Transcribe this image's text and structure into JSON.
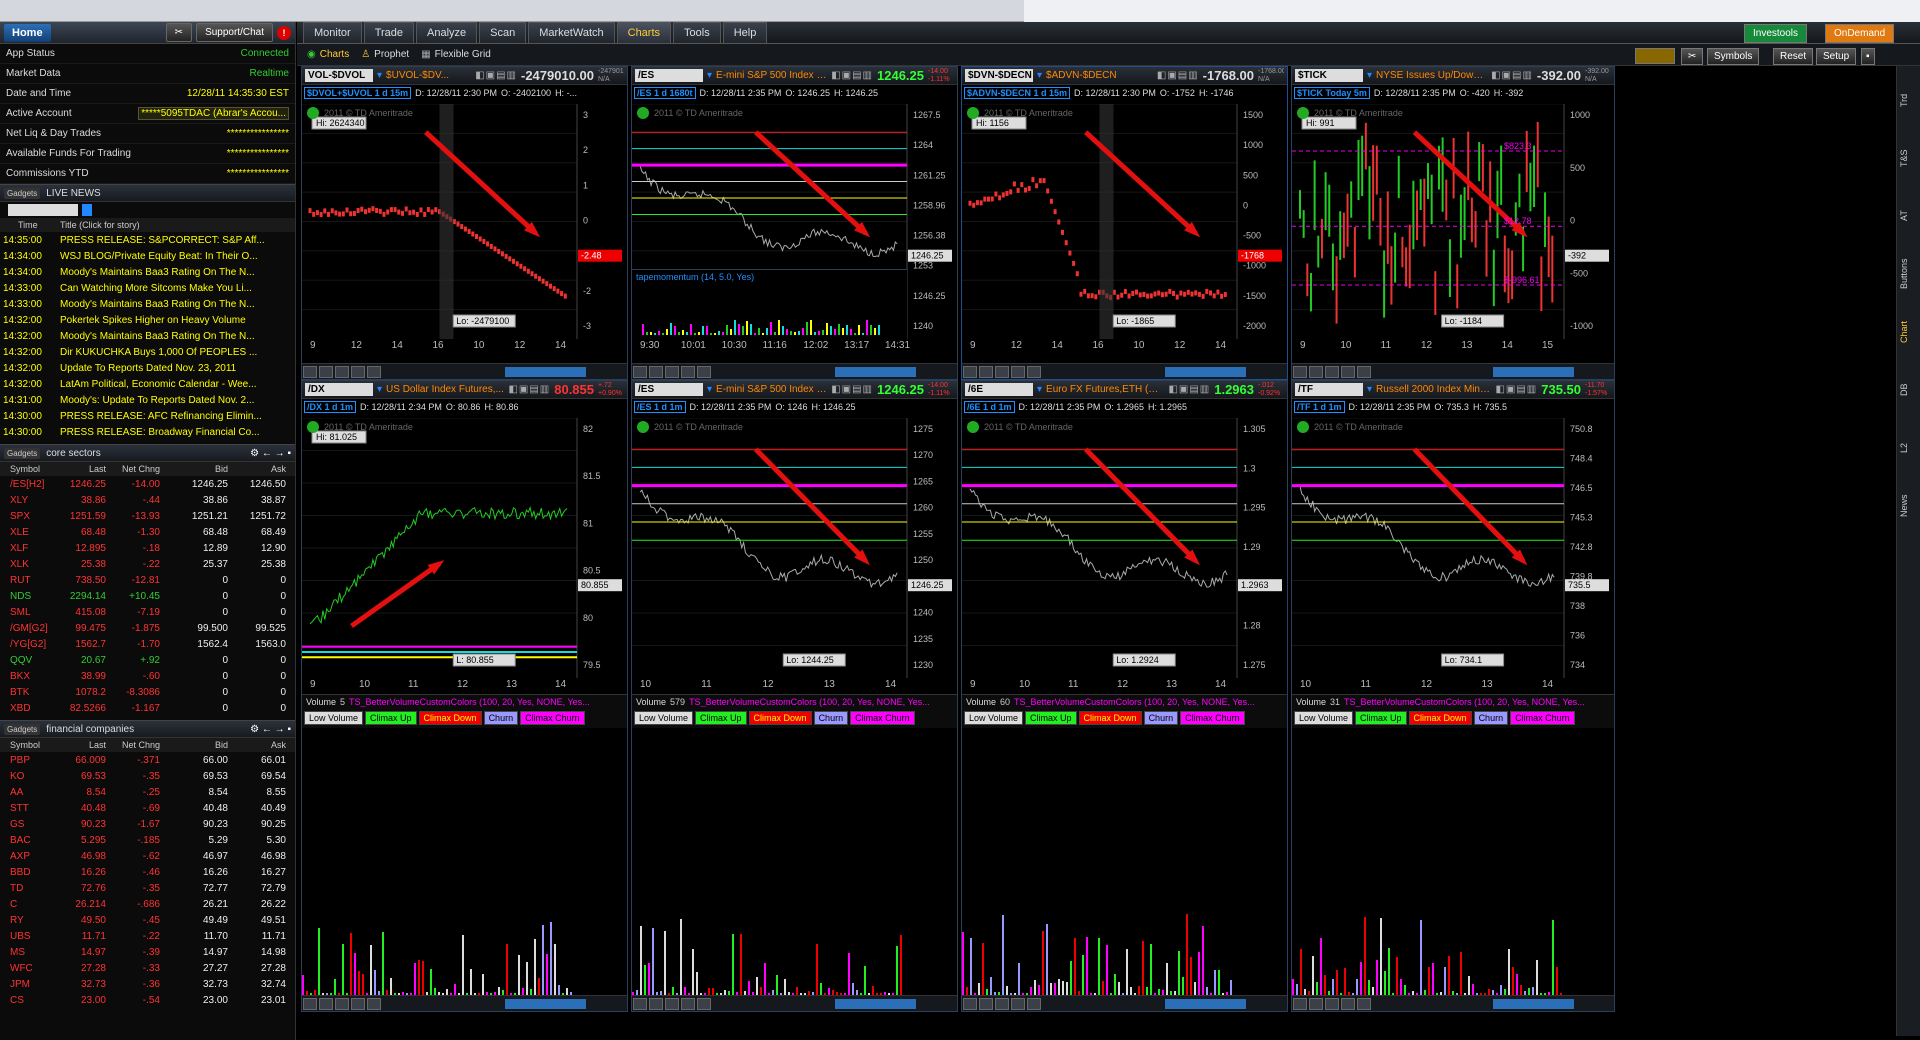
{
  "left": {
    "home": "Home",
    "support": "Support/Chat",
    "status": [
      {
        "k": "App Status",
        "v": "Connected"
      },
      {
        "k": "Market Data",
        "v": "Realtime"
      },
      {
        "k": "Date and Time",
        "v": "12/28/11 14:35:30 EST"
      },
      {
        "k": "Active Account",
        "v": "*****5095TDAC (Abrar's Accou..."
      },
      {
        "k": "Net Liq & Day Trades",
        "v": "****************"
      },
      {
        "k": "Available Funds For Trading",
        "v": "****************"
      },
      {
        "k": "Commissions YTD",
        "v": "****************"
      }
    ],
    "news_title": "LIVE NEWS",
    "gadgets": "Gadgets",
    "news_cols": [
      "Time",
      "Title (Click for story)"
    ],
    "news": [
      {
        "t": "14:35:00",
        "s": "PRESS RELEASE: S&PCORRECT: S&P Aff..."
      },
      {
        "t": "14:34:00",
        "s": "WSJ BLOG/Private Equity Beat: In Their O..."
      },
      {
        "t": "14:34:00",
        "s": "Moody's Maintains Baa3 Rating On The N..."
      },
      {
        "t": "14:33:00",
        "s": "Can Watching More Sitcoms Make You Li..."
      },
      {
        "t": "14:33:00",
        "s": "Moody's Maintains Baa3 Rating On The N..."
      },
      {
        "t": "14:32:00",
        "s": "Pokertek Spikes Higher on Heavy Volume"
      },
      {
        "t": "14:32:00",
        "s": "Moody's Maintains Baa3 Rating On The N..."
      },
      {
        "t": "14:32:00",
        "s": "Dir KUKUCHKA Buys 1,000 Of PEOPLES ..."
      },
      {
        "t": "14:32:00",
        "s": "Update To Reports Dated Nov. 23, 2011"
      },
      {
        "t": "14:32:00",
        "s": "LatAm Political, Economic Calendar - Wee..."
      },
      {
        "t": "14:31:00",
        "s": "Moody's: Update To Reports Dated Nov. 2..."
      },
      {
        "t": "14:30:00",
        "s": "PRESS RELEASE: AFC Refinancing Elimin..."
      },
      {
        "t": "14:30:00",
        "s": "PRESS RELEASE: Broadway Financial Co..."
      }
    ],
    "core_title": "core sectors",
    "quote_cols": [
      "Symbol",
      "Last",
      "Net Chng",
      "Bid",
      "Ask"
    ],
    "core": [
      [
        "/ES[H2]",
        "1246.25",
        "-14.00",
        "1246.25",
        "1246.50",
        "r"
      ],
      [
        "XLY",
        "38.86",
        "-.44",
        "38.86",
        "38.87",
        "r"
      ],
      [
        "SPX",
        "1251.59",
        "-13.93",
        "1251.21",
        "1251.72",
        "r"
      ],
      [
        "XLE",
        "68.48",
        "-1.30",
        "68.48",
        "68.49",
        "r"
      ],
      [
        "XLF",
        "12.895",
        "-.18",
        "12.89",
        "12.90",
        "r"
      ],
      [
        "XLK",
        "25.38",
        "-.22",
        "25.37",
        "25.38",
        "r"
      ],
      [
        "RUT",
        "738.50",
        "-12.81",
        "0",
        "0",
        "r"
      ],
      [
        "NDS",
        "2294.14",
        "+10.45",
        "0",
        "0",
        "g"
      ],
      [
        "SML",
        "415.08",
        "-7.19",
        "0",
        "0",
        "r"
      ],
      [
        "/GM[G2]",
        "99.475",
        "-1.875",
        "99.500",
        "99.525",
        "r"
      ],
      [
        "/YG[G2]",
        "1562.7",
        "-1.70",
        "1562.4",
        "1563.0",
        "r"
      ],
      [
        "QQV",
        "20.67",
        "+.92",
        "0",
        "0",
        "g"
      ],
      [
        "BKX",
        "38.99",
        "-.60",
        "0",
        "0",
        "r"
      ],
      [
        "BTK",
        "1078.2",
        "-8.3086",
        "0",
        "0",
        "r"
      ],
      [
        "XBD",
        "82.5266",
        "-1.167",
        "0",
        "0",
        "r"
      ]
    ],
    "fin_title": "financial companies",
    "fin": [
      [
        "PBP",
        "66.009",
        "-.371",
        "66.00",
        "66.01",
        "r"
      ],
      [
        "KO",
        "69.53",
        "-.35",
        "69.53",
        "69.54",
        "r"
      ],
      [
        "AA",
        "8.54",
        "-.25",
        "8.54",
        "8.55",
        "r"
      ],
      [
        "STT",
        "40.48",
        "-.69",
        "40.48",
        "40.49",
        "r"
      ],
      [
        "GS",
        "90.23",
        "-1.67",
        "90.23",
        "90.25",
        "r"
      ],
      [
        "BAC",
        "5.295",
        "-.185",
        "5.29",
        "5.30",
        "r"
      ],
      [
        "AXP",
        "46.98",
        "-.62",
        "46.97",
        "46.98",
        "r"
      ],
      [
        "BBD",
        "16.26",
        "-.46",
        "16.26",
        "16.27",
        "r"
      ],
      [
        "TD",
        "72.76",
        "-.35",
        "72.77",
        "72.79",
        "r"
      ],
      [
        "C",
        "26.214",
        "-.686",
        "26.21",
        "26.22",
        "r"
      ],
      [
        "RY",
        "49.50",
        "-.45",
        "49.49",
        "49.51",
        "r"
      ],
      [
        "UBS",
        "11.71",
        "-.22",
        "11.70",
        "11.71",
        "r"
      ],
      [
        "MS",
        "14.97",
        "-.39",
        "14.97",
        "14.98",
        "r"
      ],
      [
        "WFC",
        "27.28",
        "-.33",
        "27.27",
        "27.28",
        "r"
      ],
      [
        "JPM",
        "32.73",
        "-.36",
        "32.73",
        "32.74",
        "r"
      ],
      [
        "CS",
        "23.00",
        "-.54",
        "23.00",
        "23.01",
        "r"
      ]
    ]
  },
  "nav": {
    "tabs": [
      "Monitor",
      "Trade",
      "Analyze",
      "Scan",
      "MarketWatch",
      "Charts",
      "Tools",
      "Help"
    ],
    "sub": [
      "Charts",
      "Prophet",
      "Flexible Grid"
    ],
    "right": [
      "Investools",
      "OnDemand"
    ],
    "ctl": [
      "Symbols",
      "Reset",
      "Setup"
    ],
    "side": [
      "Trd",
      "T&S",
      "AT",
      "Buttons",
      "Chart",
      "DB",
      "L2",
      "News"
    ]
  },
  "panels": [
    {
      "sym": "VOL-$DVOL",
      "desc": "$UVOL-$DV...",
      "price": "-2479010.00",
      "chg": "-2479010.00 N/A",
      "pc": "",
      "info": "$DVOL+$UVOL 1 d 15m",
      "date": "D: 12/28/11 2:30 PM",
      "o": "O: -2402100",
      "h": "H: -...",
      "hi": "Hi: 2624340",
      "lo": "Lo: -2479100",
      "last": "-2.48",
      "xt": [
        "9",
        "12",
        "14",
        "16",
        "10",
        "12",
        "14"
      ],
      "yt": [
        "3",
        "2",
        "1",
        "0",
        "-1",
        "-2",
        "-3"
      ]
    },
    {
      "sym": "/ES",
      "desc": "E-mini S&P 500 Index Futur...",
      "price": "1246.25",
      "chg": "-14.00 -1.11%",
      "pc": "g",
      "info": "/ES 1 d 1680t",
      "date": "D: 12/28/11 2:35 PM",
      "o": "O: 1246.25",
      "h": "H: 1246.25",
      "hi": "",
      "lo": "Lo: 1244.25",
      "last": "1246.25",
      "xt": [
        "9:30",
        "10:01",
        "10:30",
        "11:16",
        "12:02",
        "13:17",
        "14:31"
      ],
      "yt": [
        "1267.5",
        "1264",
        "1261.25",
        "1258.96",
        "1256.38",
        "1253",
        "1246.25",
        "1240"
      ],
      "study": "tapemomentum (14, 5.0, Yes)"
    },
    {
      "sym": "$DVN-$DECN",
      "desc": "$ADVN-$DECN",
      "price": "-1768.00",
      "chg": "-1768.00 N/A",
      "pc": "",
      "info": "$ADVN-$DECN 1 d 15m",
      "date": "D: 12/28/11 2:30 PM",
      "o": "O: -1752",
      "h": "H: -1746",
      "hi": "Hi: 1156",
      "lo": "Lo: -1865",
      "last": "-1768",
      "xt": [
        "9",
        "12",
        "14",
        "16",
        "10",
        "12",
        "14"
      ],
      "yt": [
        "1500",
        "1000",
        "500",
        "0",
        "-500",
        "-1000",
        "-1500",
        "-2000"
      ]
    },
    {
      "sym": "$TICK",
      "desc": "NYSE Issues Up/Down ...",
      "price": "-392.00",
      "chg": "-392.00 N/A",
      "pc": "",
      "info": "$TICK Today 5m",
      "date": "D: 12/28/11 2:35 PM",
      "o": "O: -420",
      "h": "H: -392",
      "hi": "Hi: 991",
      "lo": "Lo: -1184",
      "last": "-392",
      "xt": [
        "9",
        "10",
        "11",
        "12",
        "13",
        "14",
        "15"
      ],
      "yt": [
        "1000",
        "500",
        "0",
        "-500",
        "-1000"
      ],
      "lines": [
        "$823.3",
        "$12.78",
        "$-996.61"
      ]
    },
    {
      "sym": "/DX",
      "desc": "US Dollar Index Futures,...",
      "price": "80.855",
      "chg": "+.72 +0.90%",
      "pc": "r",
      "info": "/DX 1 d 1m",
      "date": "D: 12/28/11 2:34 PM",
      "o": "O: 80.86",
      "h": "H: 80.86",
      "hi": "Hi: 81.025",
      "lo": "L: 80.855",
      "last": "80.855",
      "xt": [
        "9",
        "10",
        "11",
        "12",
        "13",
        "14"
      ],
      "yt": [
        "82",
        "81.5",
        "81",
        "80.5",
        "80",
        "79.5"
      ],
      "vol": "5"
    },
    {
      "sym": "/ES",
      "desc": "E-mini S&P 500 Index Fu...",
      "price": "1246.25",
      "chg": "-14.00 -1.11%",
      "pc": "g",
      "info": "/ES 1 d 1m",
      "date": "D: 12/28/11 2:35 PM",
      "o": "O: 1246",
      "h": "H: 1246.25",
      "hi": "",
      "lo": "Lo: 1244.25",
      "last": "1246.25",
      "xt": [
        "10",
        "11",
        "12",
        "13",
        "14"
      ],
      "yt": [
        "1275",
        "1270",
        "1265",
        "1260",
        "1255",
        "1250",
        "1245",
        "1240",
        "1235",
        "1230"
      ],
      "vol": "579"
    },
    {
      "sym": "/6E",
      "desc": "Euro FX Futures,ETH (M...",
      "price": "1.2963",
      "chg": "-.012 -0.92%",
      "pc": "g",
      "info": "/6E 1 d 1m",
      "date": "D: 12/28/11 2:35 PM",
      "o": "O: 1.2965",
      "h": "H: 1.2965",
      "hi": "",
      "lo": "Lo: 1.2924",
      "last": "1.2963",
      "xt": [
        "9",
        "10",
        "11",
        "12",
        "13",
        "14"
      ],
      "yt": [
        "1.305",
        "1.3",
        "1.295",
        "1.29",
        "1.285",
        "1.28",
        "1.275"
      ],
      "vol": "60"
    },
    {
      "sym": "/TF",
      "desc": "Russell 2000 Index Mini-s...",
      "price": "735.50",
      "chg": "-11.70 -1.57%",
      "pc": "g",
      "info": "/TF 1 d 1m",
      "date": "D: 12/28/11 2:35 PM",
      "o": "O: 735.3",
      "h": "H: 735.5",
      "hi": "",
      "lo": "Lo: 734.1",
      "last": "735.5",
      "xt": [
        "10",
        "11",
        "12",
        "13",
        "14"
      ],
      "yt": [
        "750.8",
        "748.4",
        "746.5",
        "745.3",
        "742.8",
        "739.8",
        "738",
        "736",
        "734"
      ],
      "vol": "31"
    }
  ],
  "volume": {
    "label": "Volume",
    "study": "TS_BetterVolumeCustomColors (100, 20, Yes, NONE, Yes...",
    "buttons": [
      "Low Volume",
      "Climax Up",
      "Climax Down",
      "Churn",
      "Climax Churn"
    ]
  },
  "copyright": "2011 © TD Ameritrade"
}
